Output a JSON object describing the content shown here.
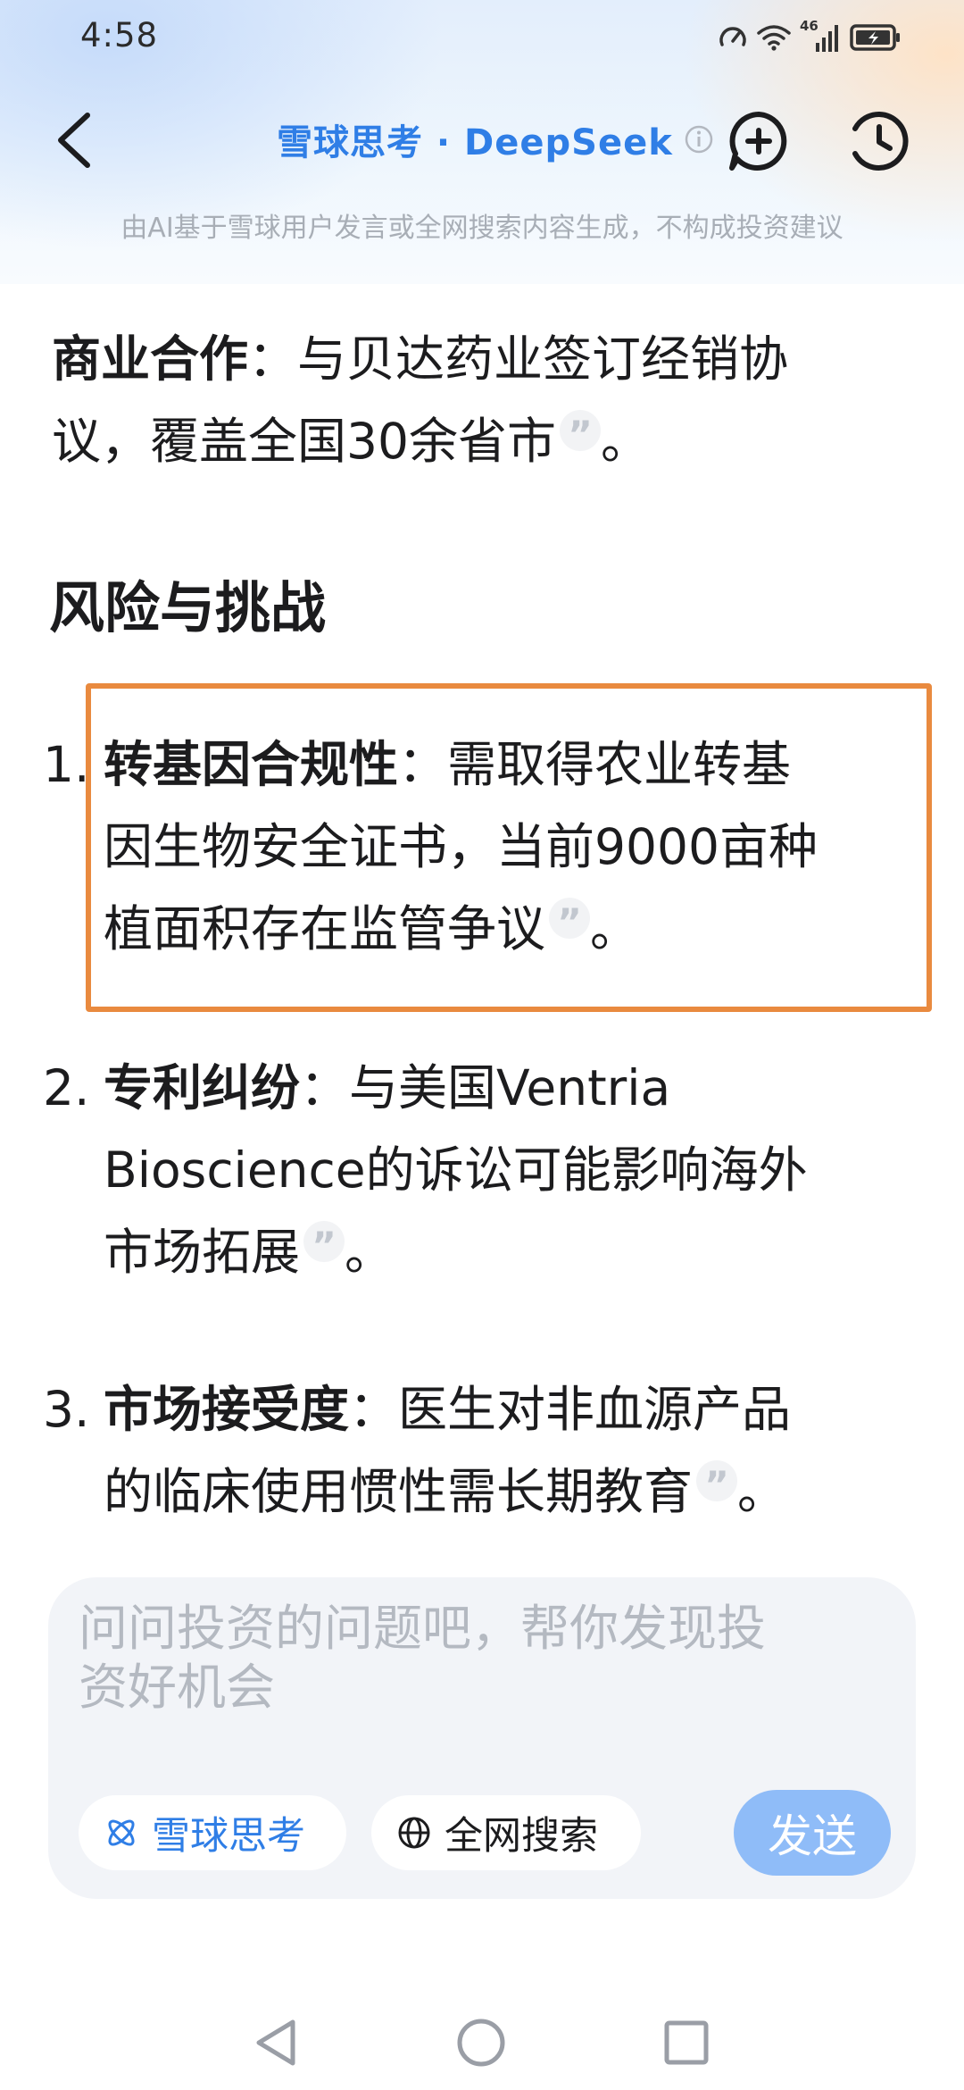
{
  "status_bar": {
    "time": "4:58",
    "network_label": "46"
  },
  "nav": {
    "title": "雪球思考 · DeepSeek",
    "icons": [
      "back-arrow-icon",
      "info-icon",
      "new-chat-icon",
      "history-clock-icon"
    ]
  },
  "disclaimer": "由AI基于雪球用户发言或全网搜索内容生成，不构成投资建议",
  "content": {
    "cooperation": {
      "label": "商业合作",
      "text_line1": "：与贝达药业签订经销协",
      "text_line2": "议，覆盖全国30余省市",
      "end": "。"
    },
    "risk_heading": "风险与挑战",
    "risks": [
      {
        "num": "1.",
        "label": "转基因合规性",
        "line1": "：需取得农业转基",
        "line2": "因生物安全证书，当前9000亩种",
        "line3": "植面积存在监管争议",
        "end": "。"
      },
      {
        "num": "2.",
        "label": "专利纠纷",
        "line1": "：与美国Ventria",
        "line2": "Bioscience的诉讼可能影响海外",
        "line3": "市场拓展",
        "end": "。"
      },
      {
        "num": "3.",
        "label": "市场接受度",
        "line1": "：医生对非血源产品",
        "line2": "的临床使用惯性需长期教育",
        "end": "。"
      }
    ],
    "quote_glyph": "”"
  },
  "input": {
    "placeholder_line1": "问问投资的问题吧，帮你发现投",
    "placeholder_line2": "资好机会",
    "chip_xueqiu": "雪球思考",
    "chip_web": "全网搜索",
    "send": "发送"
  },
  "colors": {
    "accent_blue": "#2f7ee6",
    "send_button": "#8fbcf8",
    "highlight_border": "#e98a3f"
  }
}
